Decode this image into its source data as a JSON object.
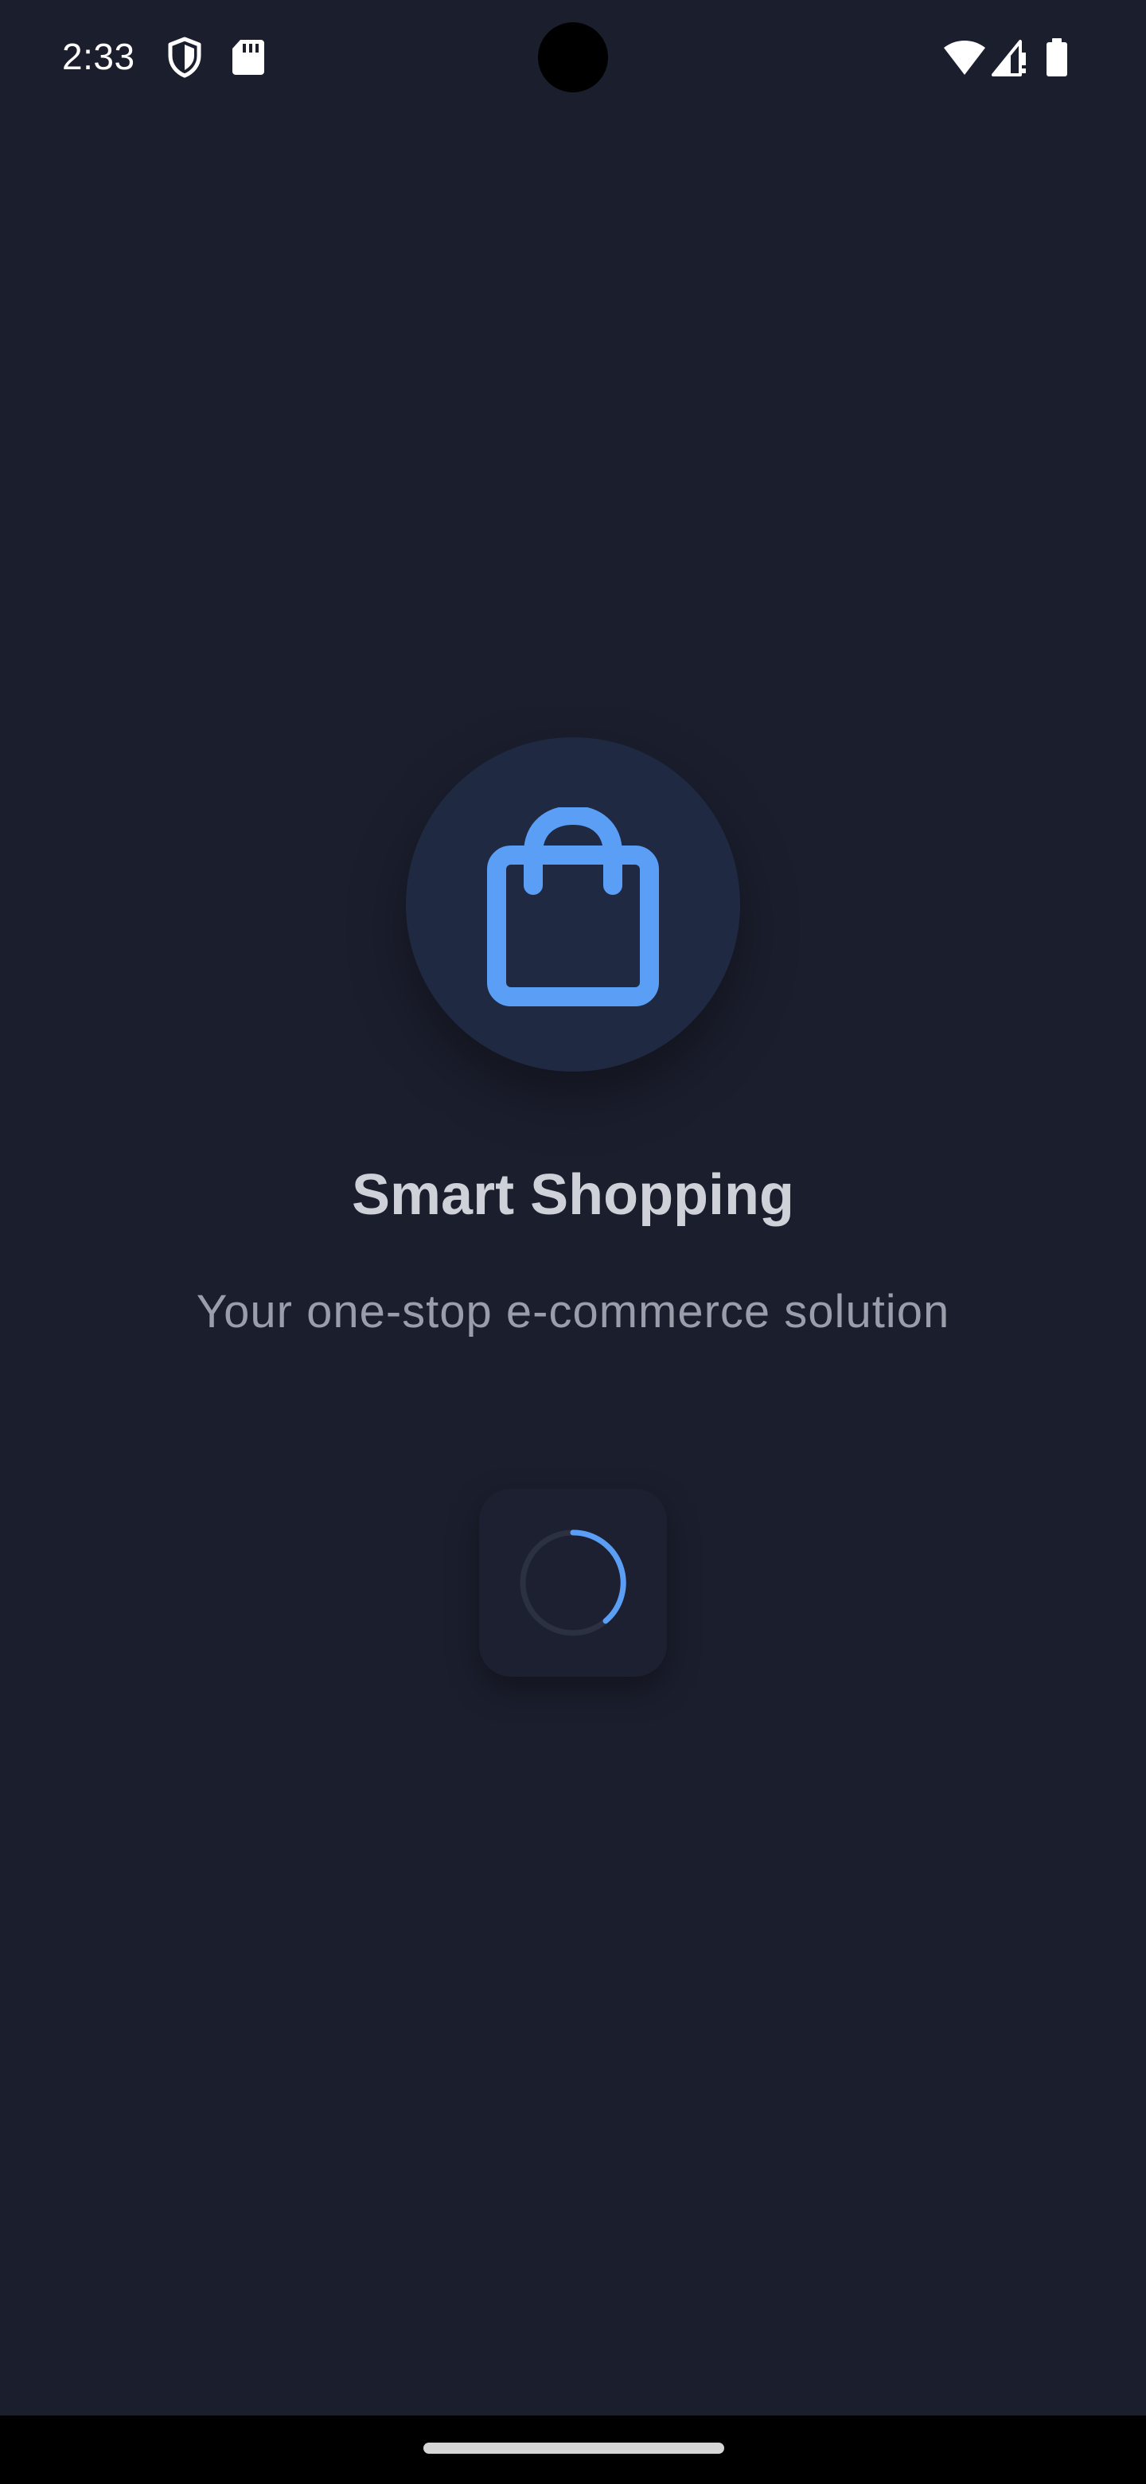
{
  "status_bar": {
    "time": "2:33",
    "icons": [
      "shield-icon",
      "sd-card-icon",
      "wifi-icon",
      "signal-icon",
      "battery-icon"
    ]
  },
  "splash": {
    "logo_icon": "shopping-bag-icon",
    "title": "Smart Shopping",
    "subtitle": "Your one-stop e-commerce solution",
    "loading_indicator": "spinner"
  },
  "colors": {
    "background": "#1b1e2d",
    "accent": "#5b9ef5",
    "logo_circle": "#1f2a42",
    "title": "#cfd1d9",
    "subtitle": "#9a9eab"
  }
}
